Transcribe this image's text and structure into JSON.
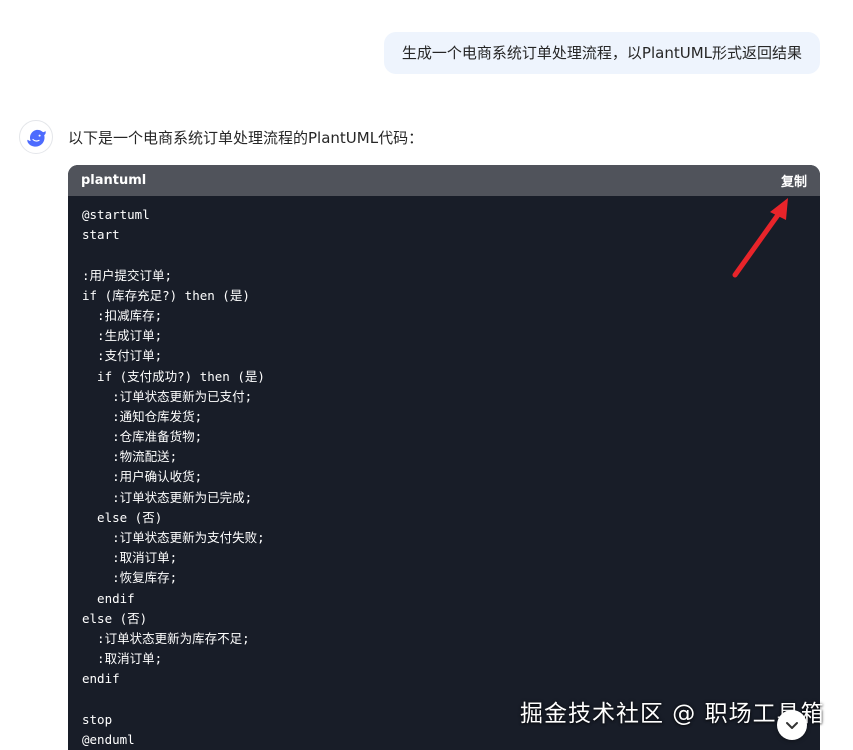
{
  "chat": {
    "user_message": "生成一个电商系统订单处理流程，以PlantUML形式返回结果",
    "assistant_intro": "以下是一个电商系统订单处理流程的PlantUML代码："
  },
  "code_block": {
    "language": "plantuml",
    "copy_label": "复制",
    "lines": [
      "@startuml",
      "start",
      "",
      ":用户提交订单;",
      "if (库存充足?) then (是)",
      "  :扣减库存;",
      "  :生成订单;",
      "  :支付订单;",
      "  if (支付成功?) then (是)",
      "    :订单状态更新为已支付;",
      "    :通知仓库发货;",
      "    :仓库准备货物;",
      "    :物流配送;",
      "    :用户确认收货;",
      "    :订单状态更新为已完成;",
      "  else (否)",
      "    :订单状态更新为支付失败;",
      "    :取消订单;",
      "    :恢复库存;",
      "  endif",
      "else (否)",
      "  :订单状态更新为库存不足;",
      "  :取消订单;",
      "endif",
      "",
      "stop",
      "@enduml"
    ]
  },
  "watermark": "掘金技术社区 @ 职场工具箱",
  "colors": {
    "user_bubble_bg": "#eef4fd",
    "code_bg": "#181d28",
    "code_header_bg": "#50535b",
    "annotation_arrow": "#e8242a",
    "brand_blue": "#4d6bfe"
  },
  "icons": {
    "avatar": "deepseek-whale-icon",
    "scroll": "chevron-down-icon"
  }
}
